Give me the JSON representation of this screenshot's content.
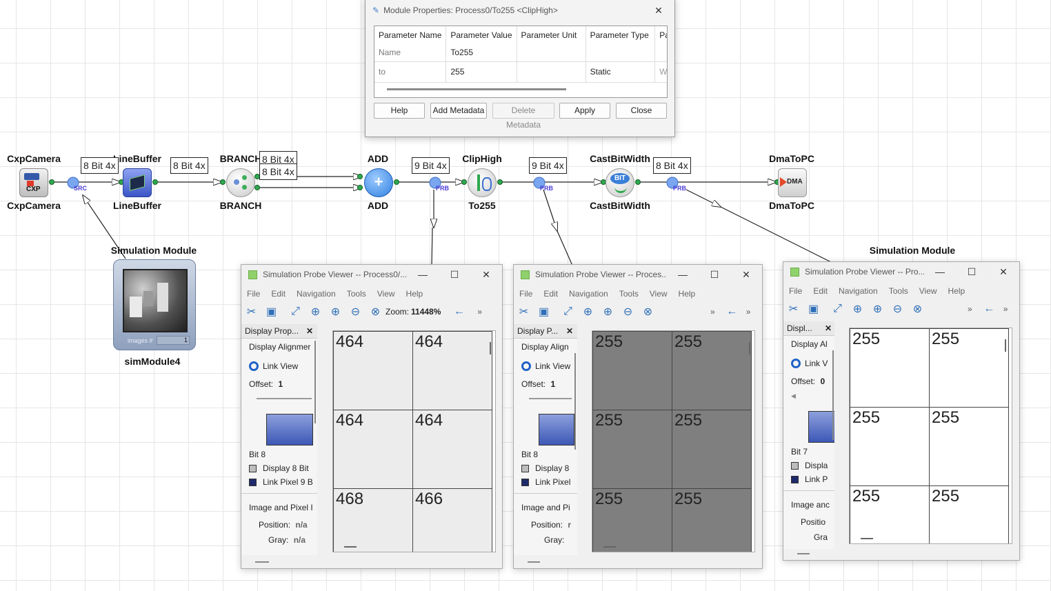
{
  "dialog": {
    "title": "Module Properties: Process0/To255 <ClipHigh>",
    "columns": [
      "Parameter Name",
      "Parameter Value",
      "Parameter Unit",
      "Parameter Type",
      "Pa"
    ],
    "rows": [
      [
        "Name",
        "To255",
        "",
        "",
        ""
      ],
      [
        "to",
        "255",
        "",
        "Static",
        "Wri"
      ]
    ],
    "buttons": {
      "help": "Help",
      "add_metadata": "Add Metadata",
      "delete_metadata": "Delete Metadata",
      "apply": "Apply",
      "close": "Close"
    }
  },
  "modules": {
    "cxp_top": "CxpCamera",
    "cxp_bottom": "CxpCamera",
    "cxp_icon": "CXP",
    "linebuffer_top": "LineBuffer",
    "linebuffer_bottom": "LineBuffer",
    "branch_top": "BRANCH",
    "branch_bottom": "BRANCH",
    "add_top": "ADD",
    "add_bottom": "ADD",
    "cliphigh_top": "ClipHigh",
    "cliphigh_bottom": "To255",
    "cast_top": "CastBitWidth",
    "cast_bottom": "CastBitWidth",
    "cast_icon": "BIT",
    "dma_top": "DmaToPC",
    "dma_bottom": "DmaToPC",
    "dma_icon": "DMA",
    "sim_top": "Simulation Module",
    "sim_bottom": "simModule4",
    "sim_images_label": "images #",
    "sim_images_count": "1",
    "sim2_top": "Simulation Module",
    "src_label": "SRC",
    "prb_label": "PRB"
  },
  "tooltips": [
    "8 Bit 4x",
    "8 Bit 4x",
    "8 Bit 4x",
    "8 Bit 4x",
    "9 Bit 4x",
    "9 Bit 4x",
    "8 Bit 4x"
  ],
  "viewers": [
    {
      "title": "Simulation Probe Viewer -- Process0/...",
      "menu": [
        "File",
        "Edit",
        "Navigation",
        "Tools",
        "View",
        "Help"
      ],
      "zoom_label": "Zoom:",
      "zoom_value": "11448%",
      "panel_title": "Display Prop...",
      "alignment": "Display Alignmer",
      "link_view": "Link View",
      "offset_label": "Offset:",
      "offset_value": "1",
      "bit_label": "Bit 8",
      "legend1": "Display 8 Bit",
      "legend2": "Link Pixel 9 B",
      "section2": "Image and Pixel I",
      "position_label": "Position:",
      "position_value": "n/a",
      "gray_label": "Gray:",
      "gray_value": "n/a",
      "cells": [
        "464",
        "464",
        "464",
        "464",
        "468",
        "466"
      ],
      "cell_bg": "#ececec"
    },
    {
      "title": "Simulation Probe Viewer -- Proces...",
      "menu": [
        "File",
        "Edit",
        "Navigation",
        "Tools",
        "View",
        "Help"
      ],
      "panel_title": "Display P...",
      "alignment": "Display Align",
      "link_view": "Link View",
      "offset_label": "Offset:",
      "offset_value": "1",
      "bit_label": "Bit 8",
      "legend1": "Display 8",
      "legend2": "Link Pixel",
      "section2": "Image and Pi",
      "position_label": "Position:",
      "position_value": "r",
      "gray_label": "Gray:",
      "gray_value": "",
      "cells": [
        "255",
        "255",
        "255",
        "255",
        "255",
        "255"
      ],
      "cell_bg": "#7f7f7f"
    },
    {
      "title": "Simulation Probe Viewer -- Pro...",
      "menu": [
        "File",
        "Edit",
        "Navigation",
        "Tools",
        "View",
        "Help"
      ],
      "panel_title": "Displ...",
      "alignment": "Display Al",
      "link_view": "Link V",
      "offset_label": "Offset:",
      "offset_value": "0",
      "bit_label": "Bit 7",
      "legend1": "Displa",
      "legend2": "Link P",
      "section2": "Image anc",
      "position_label": "Positio",
      "position_value": "",
      "gray_label": "Gra",
      "gray_value": "",
      "cells": [
        "255",
        "255",
        "255",
        "255",
        "255",
        "255"
      ],
      "cell_bg": "#ffffff"
    }
  ]
}
